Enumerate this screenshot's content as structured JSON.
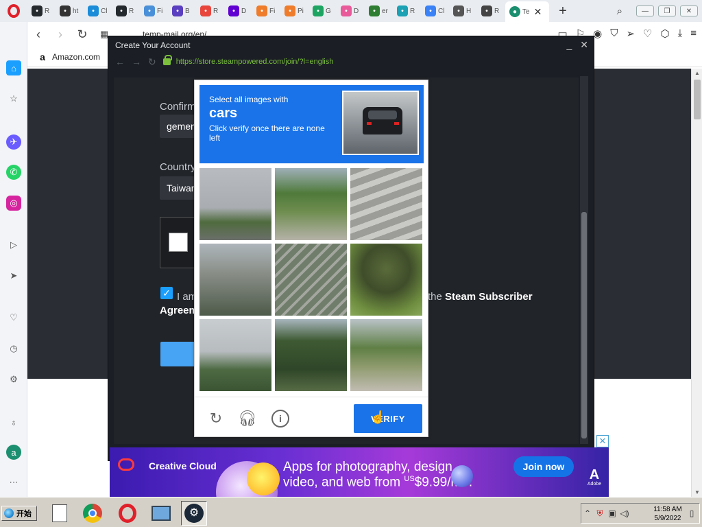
{
  "browser": {
    "tabs": [
      {
        "label": "R",
        "icon": "github-icon",
        "color": "#24292e"
      },
      {
        "label": "ht",
        "icon": "dark-circle-icon",
        "color": "#333333"
      },
      {
        "label": "Cl",
        "icon": "cloud-icon",
        "color": "#1a8cd8"
      },
      {
        "label": "R",
        "icon": "github-icon",
        "color": "#24292e"
      },
      {
        "label": "Fi",
        "icon": "search-icon",
        "color": "#4a90d9"
      },
      {
        "label": "B",
        "icon": "bitwarden-icon",
        "color": "#5a3fc0"
      },
      {
        "label": "R",
        "icon": "reddit-icon",
        "color": "#e8453c"
      },
      {
        "label": "D",
        "icon": "yahoo-icon",
        "color": "#6001d2"
      },
      {
        "label": "Fi",
        "icon": "cloud-icon",
        "color": "#ee7c2b"
      },
      {
        "label": "Pi",
        "icon": "cloud-icon",
        "color": "#ee7c2b"
      },
      {
        "label": "G",
        "icon": "drive-icon",
        "color": "#1da462"
      },
      {
        "label": "D",
        "icon": "link-icon",
        "color": "#e85a9a"
      },
      {
        "label": "er",
        "icon": "search-icon",
        "color": "#2e7d32"
      },
      {
        "label": "R",
        "icon": "plane-icon",
        "color": "#1ca0b3"
      },
      {
        "label": "Cl",
        "icon": "link-icon",
        "color": "#3b82f6"
      },
      {
        "label": "H",
        "icon": "roblox-icon",
        "color": "#555555"
      },
      {
        "label": "R",
        "icon": "globe-icon",
        "color": "#444444"
      }
    ],
    "active_tab": {
      "label": "Te",
      "icon": "temp-mail-icon",
      "color": "#1b8f6f"
    },
    "address": "temp-mail.org/en/",
    "bookmark": "Amazon.com"
  },
  "steam_window": {
    "title": "Create Your Account",
    "url": "https://store.steampowered.com/join/?l=english",
    "confirm_label": "Confirm",
    "confirm_value": "gemen",
    "country_label": "Country",
    "country_value": "Taiwan",
    "agree_prefix": "I am",
    "agree_mid": "the",
    "agree_bold": "Steam Subscriber",
    "agree_line2": "Agreem"
  },
  "recaptcha": {
    "instruction": "Select all images with",
    "target": "cars",
    "hint": "Click verify once there are none left",
    "verify_label": "VERIFY",
    "tiles": [
      {
        "scene": "cloudy-sky-trees"
      },
      {
        "scene": "cyclist-path"
      },
      {
        "scene": "crosswalk"
      },
      {
        "scene": "traffic-light"
      },
      {
        "scene": "stairs"
      },
      {
        "scene": "palm-tree"
      },
      {
        "scene": "trees-overcast"
      },
      {
        "scene": "pine-trees"
      },
      {
        "scene": "park-path"
      }
    ]
  },
  "ad": {
    "brand": "Creative Cloud",
    "line1": "Apps for photography, design,",
    "line2": "video, and web from",
    "price_prefix": "US",
    "price": "$9.99/mo.",
    "cta": "Join now",
    "logo_text": "Adobe"
  },
  "taskbar": {
    "start_label": "开始",
    "time": "11:58 AM",
    "date": "5/9/2022"
  }
}
